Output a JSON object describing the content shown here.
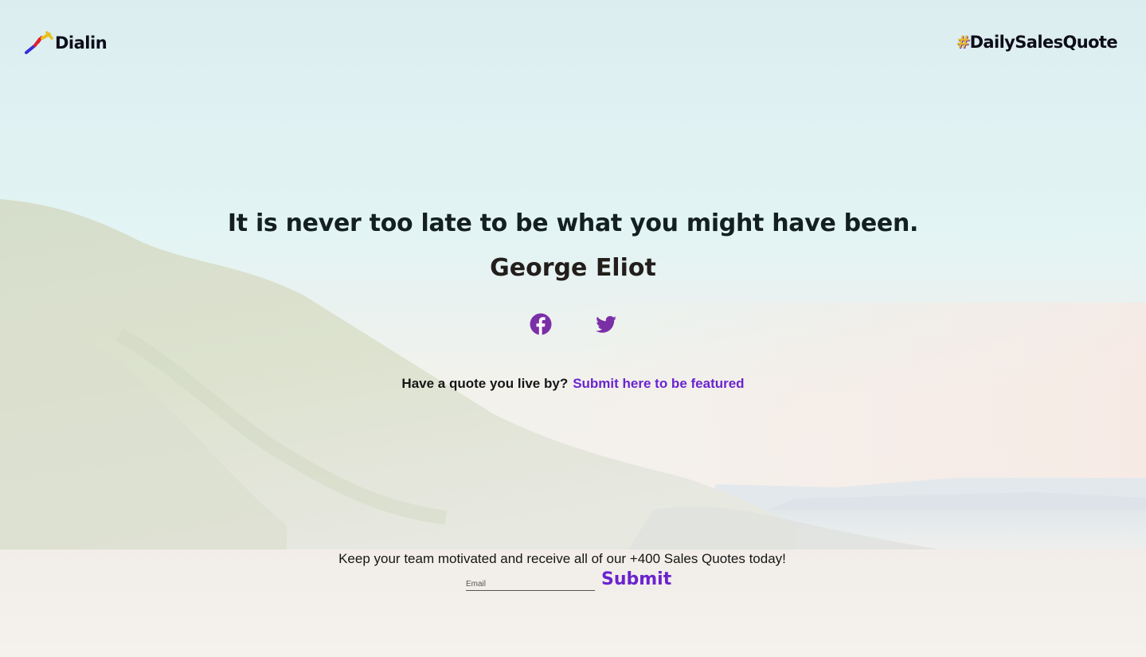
{
  "brand": {
    "name": "Dialin",
    "hashtag_symbol": "#",
    "hashtag_text": "DailySalesQuote"
  },
  "quote": {
    "text": "It is never too late to be what you might have been.",
    "author": "George Eliot"
  },
  "social": {
    "facebook_icon": "facebook-icon",
    "twitter_icon": "twitter-icon"
  },
  "cta": {
    "question": "Have a quote you live by?",
    "link_text": "Submit here to be featured"
  },
  "signup": {
    "text": "Keep your team motivated and receive all of our +400 Sales Quotes today!",
    "email_placeholder": "Email",
    "submit_label": "Submit"
  },
  "colors": {
    "accent": "#6a24cf",
    "icon_purple": "#7a2fa6",
    "text_dark": "#13201f"
  }
}
